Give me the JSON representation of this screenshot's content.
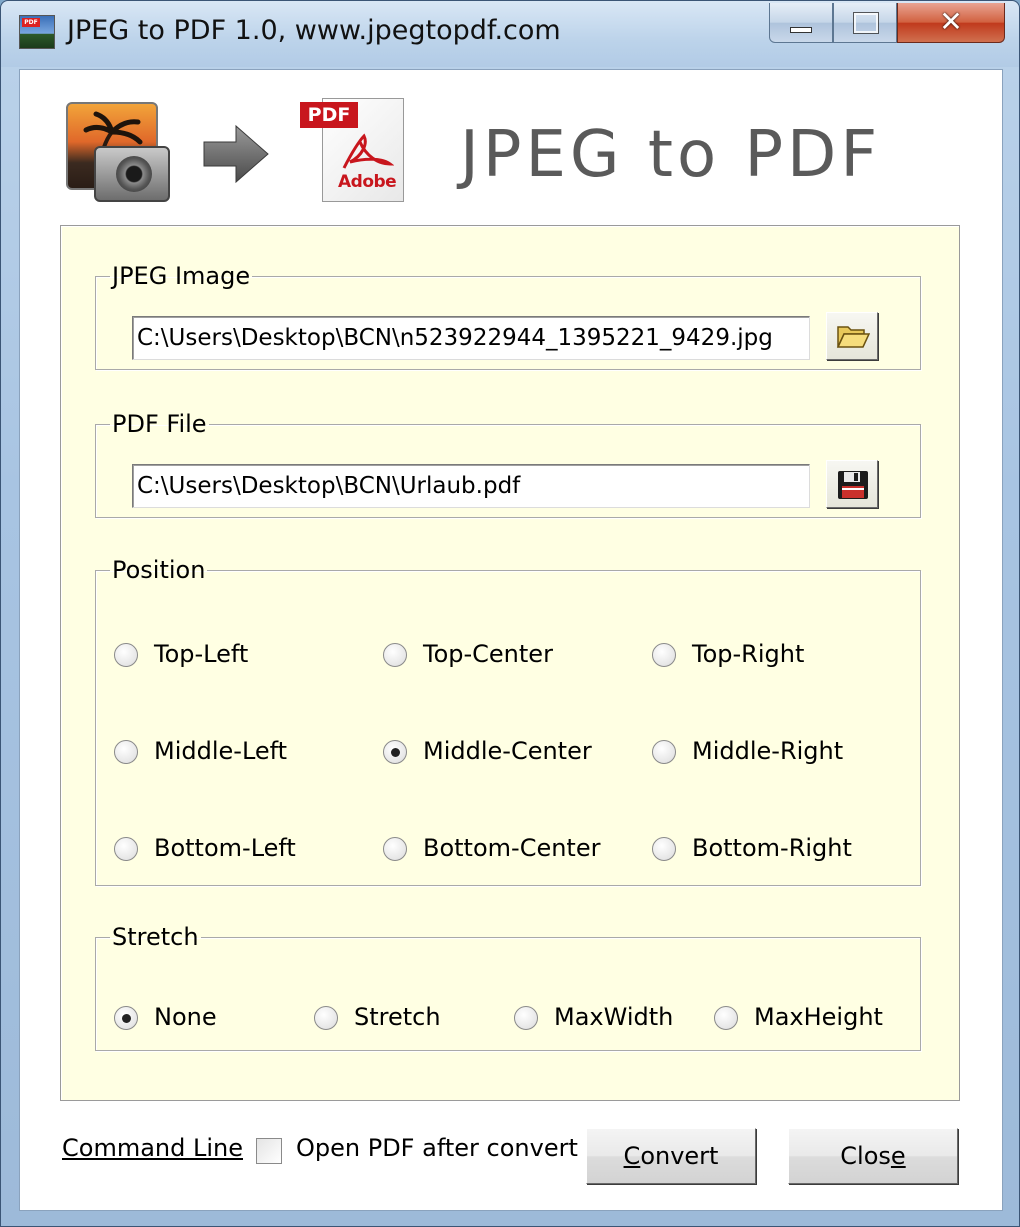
{
  "window": {
    "title": "JPEG to PDF 1.0, www.jpegtopdf.com",
    "controls": {
      "minimize": "minimize",
      "maximize": "maximize",
      "close": "✕"
    }
  },
  "header": {
    "title": "JPEG to PDF",
    "pdf_badge": "PDF",
    "pdf_brand": "Adobe",
    "icon_badge": "PDF"
  },
  "jpeg_group": {
    "legend": "JPEG Image",
    "path": "C:\\Users\\Desktop\\BCN\\n523922944_1395221_9429.jpg"
  },
  "pdf_group": {
    "legend": "PDF File",
    "path": "C:\\Users\\Desktop\\BCN\\Urlaub.pdf"
  },
  "position": {
    "legend": "Position",
    "options": [
      "Top-Left",
      "Top-Center",
      "Top-Right",
      "Middle-Left",
      "Middle-Center",
      "Middle-Right",
      "Bottom-Left",
      "Bottom-Center",
      "Bottom-Right"
    ],
    "selected": "Middle-Center"
  },
  "stretch": {
    "legend": "Stretch",
    "options": [
      "None",
      "Stretch",
      "MaxWidth",
      "MaxHeight"
    ],
    "selected": "None"
  },
  "footer": {
    "command_line": "Command Line",
    "open_pdf_label": "Open PDF after convert",
    "open_pdf_checked": false,
    "convert_first": "C",
    "convert_rest": "onvert",
    "close_first": "Clos",
    "close_underlined": "e"
  },
  "colors": {
    "panel_bg": "#ffffe3",
    "accent_red": "#c8161d",
    "title_gray": "#5a5a5a"
  }
}
